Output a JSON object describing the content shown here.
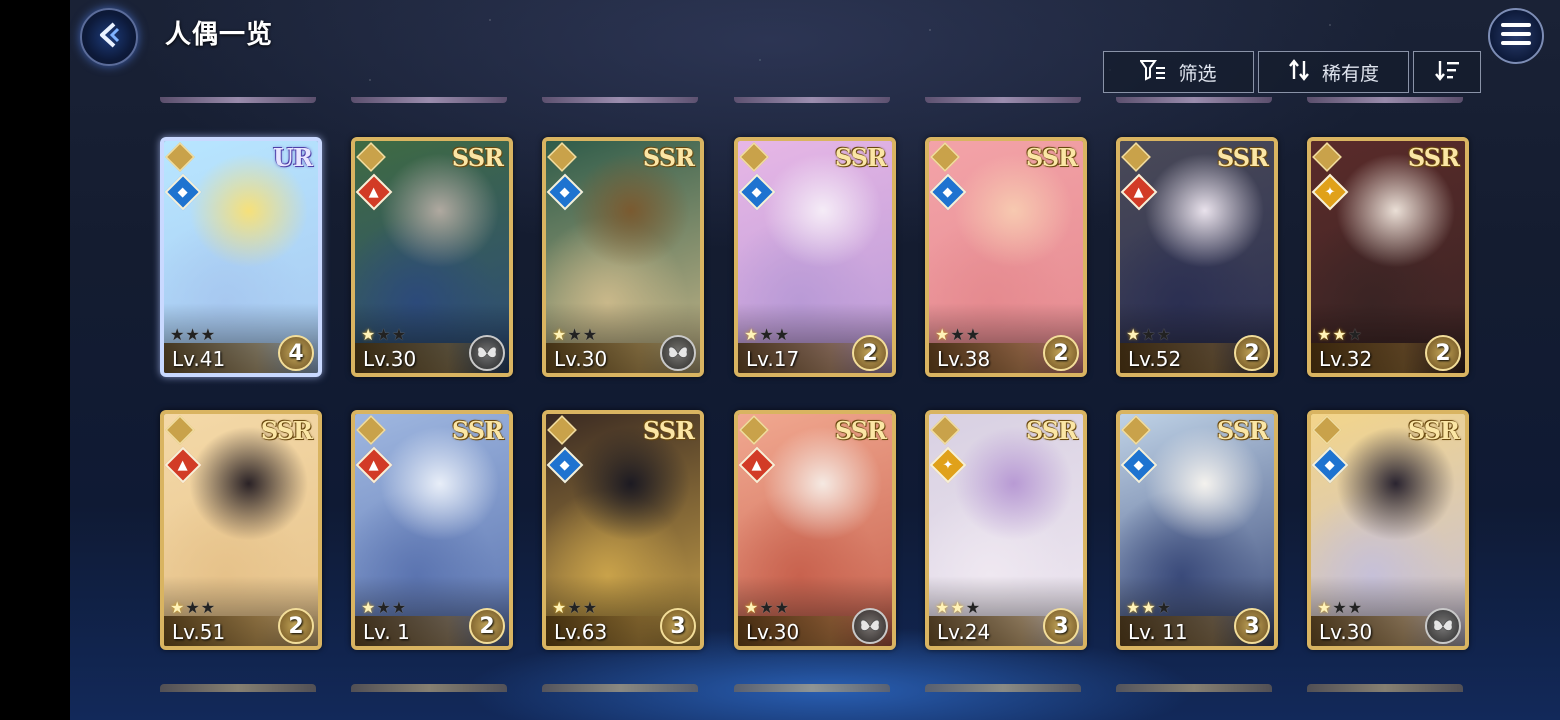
{
  "header": {
    "title": "人偶一览",
    "filter_label": "筛选",
    "rarity_sort_label": "稀有度"
  },
  "colors": {
    "gold_frame": "#d9b461",
    "ur_frame": "#c9d9ff",
    "water": "#1e73d0",
    "fire": "#d23b26",
    "light": "#e0a11a"
  },
  "cards": [
    {
      "rarity": "UR",
      "element": "water",
      "level": "Lv.41",
      "stars": 0,
      "badge": "4",
      "art": [
        "#b8e6ff",
        "#f6e07a",
        "#a7c8f0"
      ]
    },
    {
      "rarity": "SSR",
      "element": "fire",
      "level": "Lv.30",
      "stars": 1,
      "badge": "",
      "art": [
        "#3f6b42",
        "#b0a9a0",
        "#2c4a7a"
      ]
    },
    {
      "rarity": "SSR",
      "element": "water",
      "level": "Lv.30",
      "stars": 1,
      "badge": "",
      "art": [
        "#2f5c4a",
        "#7a5a30",
        "#c9b88a"
      ]
    },
    {
      "rarity": "SSR",
      "element": "water",
      "level": "Lv.17",
      "stars": 1,
      "badge": "2",
      "art": [
        "#e7b7e6",
        "#f5ecf7",
        "#b99ad6"
      ]
    },
    {
      "rarity": "SSR",
      "element": "water",
      "level": "Lv.38",
      "stars": 1,
      "badge": "2",
      "art": [
        "#f3a3a8",
        "#f7c9b0",
        "#e58a8f"
      ]
    },
    {
      "rarity": "SSR",
      "element": "fire",
      "level": "Lv.52",
      "stars": 1,
      "badge": "2",
      "art": [
        "#4a4a58",
        "#e9e2ec",
        "#2b2f52"
      ]
    },
    {
      "rarity": "SSR",
      "element": "light",
      "level": "Lv.32",
      "stars": 2,
      "badge": "2",
      "art": [
        "#5a2b2a",
        "#eadfd6",
        "#3a2424"
      ]
    },
    {
      "rarity": "SSR",
      "element": "fire",
      "level": "Lv.51",
      "stars": 1,
      "badge": "2",
      "art": [
        "#f4d9a8",
        "#2a2226",
        "#e6c28a"
      ]
    },
    {
      "rarity": "SSR",
      "element": "fire",
      "level": "Lv. 1",
      "stars": 1,
      "badge": "2",
      "art": [
        "#9fb7e0",
        "#e8eef8",
        "#5b74b0"
      ]
    },
    {
      "rarity": "SSR",
      "element": "water",
      "level": "Lv.63",
      "stars": 1,
      "badge": "3",
      "art": [
        "#3a2a22",
        "#1c1a22",
        "#c9a24a"
      ]
    },
    {
      "rarity": "SSR",
      "element": "fire",
      "level": "Lv.30",
      "stars": 1,
      "badge": "",
      "art": [
        "#f1a890",
        "#f5e9e2",
        "#c8624e"
      ]
    },
    {
      "rarity": "SSR",
      "element": "light",
      "level": "Lv.24",
      "stars": 2,
      "badge": "3",
      "art": [
        "#d8d0e2",
        "#b89ad4",
        "#efe8f1"
      ]
    },
    {
      "rarity": "SSR",
      "element": "water",
      "level": "Lv. 11",
      "stars": 2,
      "badge": "3",
      "art": [
        "#bfd2e6",
        "#f4f2ee",
        "#3a4a7a"
      ]
    },
    {
      "rarity": "SSR",
      "element": "water",
      "level": "Lv.30",
      "stars": 1,
      "badge": "",
      "art": [
        "#f3d58a",
        "#2a2430",
        "#c6c0d8"
      ]
    }
  ]
}
